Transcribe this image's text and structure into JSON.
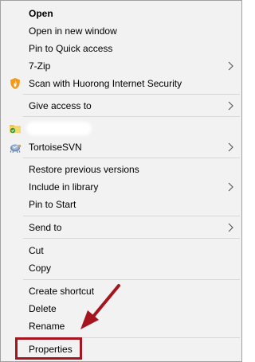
{
  "menu": {
    "items": [
      {
        "label": "Open"
      },
      {
        "label": "Open in new window"
      },
      {
        "label": "Pin to Quick access"
      },
      {
        "label": "7-Zip"
      },
      {
        "label": "Scan with Huorong Internet Security",
        "icon": "huorong-shield-icon"
      },
      {
        "label": "Give access to"
      },
      {
        "label": "",
        "icon": "folder-sync-icon"
      },
      {
        "label": "TortoiseSVN",
        "icon": "tortoisesvn-icon"
      },
      {
        "label": "Restore previous versions"
      },
      {
        "label": "Include in library"
      },
      {
        "label": "Pin to Start"
      },
      {
        "label": "Send to"
      },
      {
        "label": "Cut"
      },
      {
        "label": "Copy"
      },
      {
        "label": "Create shortcut"
      },
      {
        "label": "Delete"
      },
      {
        "label": "Rename"
      },
      {
        "label": "Properties"
      }
    ]
  },
  "colors": {
    "menu_background": "#f2f2f2",
    "separator": "#d7d7d7",
    "annotation_red": "#a6151f"
  }
}
